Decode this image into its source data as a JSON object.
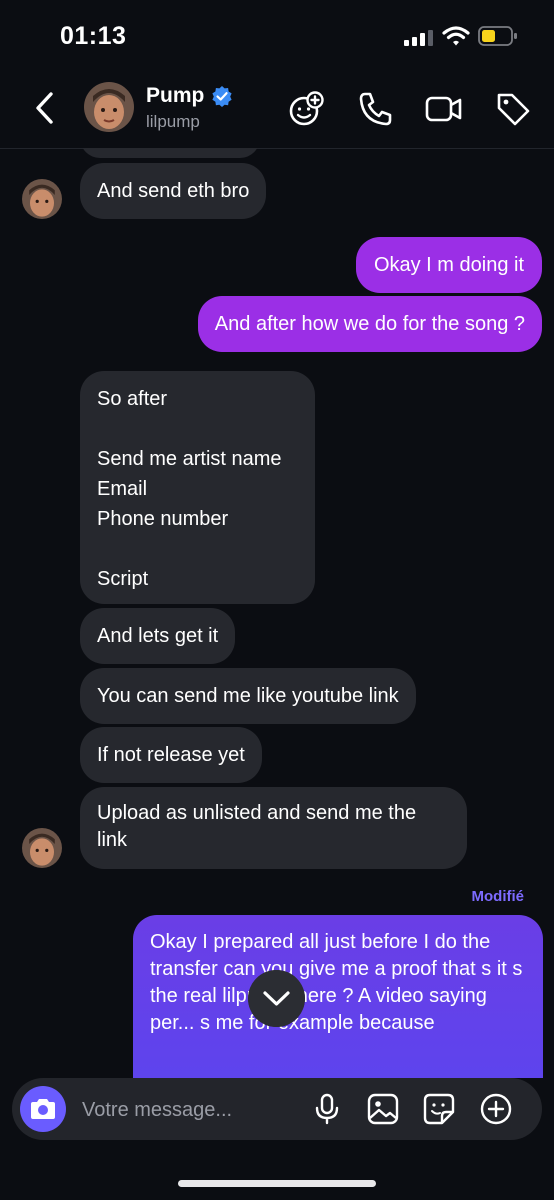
{
  "status_bar": {
    "time": "01:13"
  },
  "header": {
    "name": "Pump",
    "handle": "lilpump",
    "verified": true
  },
  "messages": [
    {
      "from": "them",
      "text": "And send eth bro"
    },
    {
      "from": "me",
      "text": "Okay I m doing it"
    },
    {
      "from": "me",
      "text": "And after how we do for the song ?"
    },
    {
      "from": "them",
      "text": "So after\n\nSend me artist name\nEmail\nPhone number\n\nScript"
    },
    {
      "from": "them",
      "text": "And lets get it"
    },
    {
      "from": "them",
      "text": "You can send me like youtube link"
    },
    {
      "from": "them",
      "text": "If not release yet"
    },
    {
      "from": "them",
      "text": "Upload as unlisted and send me the link"
    },
    {
      "from": "me",
      "text": "Okay I prepared all just before I do the transfer can you give me a proof that s it s the real lilpump there ? A video saying per... s me for example because",
      "edited_label": "Modifié"
    }
  ],
  "composer": {
    "placeholder": "Votre message..."
  },
  "icons": [
    "chevron-left-icon",
    "verified-badge-icon",
    "emoji-add-icon",
    "phone-icon",
    "video-icon",
    "tag-icon",
    "camera-icon",
    "microphone-icon",
    "image-icon",
    "sticker-icon",
    "plus-circle-icon",
    "chevron-down-icon"
  ],
  "colors": {
    "background": "#0b0d12",
    "incoming_bubble": "#26282e",
    "outgoing_bubble": "#9b2fe6",
    "outgoing_bubble_latest": "#5b45ef",
    "accent": "#6a5cff",
    "verified": "#3b8cf5",
    "battery": "#f7d31c"
  }
}
